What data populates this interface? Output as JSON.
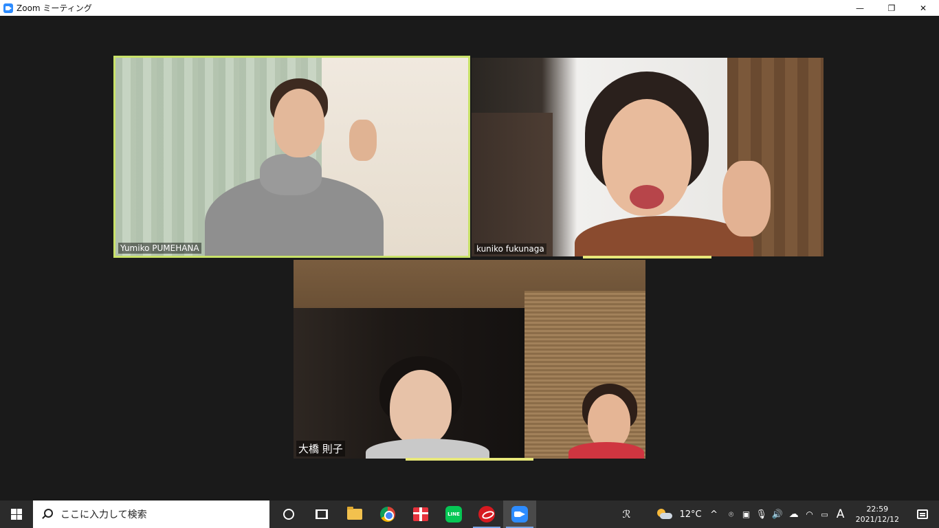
{
  "window": {
    "title": "Zoom ミーティング",
    "controls": {
      "minimize": "—",
      "maximize": "❐",
      "close": "✕"
    }
  },
  "participants": [
    {
      "name": "Yumiko PUMEHANA",
      "active_speaker": true
    },
    {
      "name": "kuniko fukunaga",
      "active_speaker": false
    },
    {
      "name": "大橋 則子",
      "active_speaker": false
    }
  ],
  "taskbar": {
    "search_placeholder": "ここに入力して検索",
    "apps": [
      "cortana-icon",
      "task-view-icon",
      "file-explorer-icon",
      "chrome-icon",
      "gift-icon",
      "line-icon",
      "trend-micro-icon",
      "zoom-icon"
    ],
    "line_label": "LINE",
    "tray": {
      "people": "ℛ",
      "temperature": "12°C",
      "chevron": "^",
      "ime": "A",
      "time": "22:59",
      "date": "2021/12/12"
    }
  }
}
